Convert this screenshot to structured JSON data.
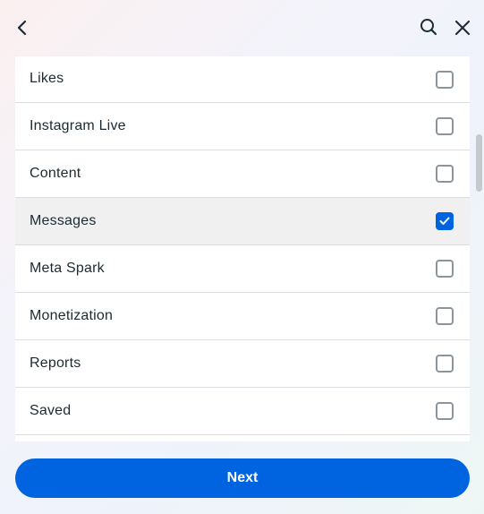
{
  "header": {
    "back_icon": "chevron-left-icon",
    "search_icon": "search-icon",
    "close_icon": "close-icon"
  },
  "list": {
    "items": [
      {
        "label": "Likes",
        "checked": false
      },
      {
        "label": "Instagram Live",
        "checked": false
      },
      {
        "label": "Content",
        "checked": false
      },
      {
        "label": "Messages",
        "checked": true
      },
      {
        "label": "Meta Spark",
        "checked": false
      },
      {
        "label": "Monetization",
        "checked": false
      },
      {
        "label": "Reports",
        "checked": false
      },
      {
        "label": "Saved",
        "checked": false
      },
      {
        "label": "",
        "checked": false
      }
    ]
  },
  "footer": {
    "next_label": "Next"
  },
  "colors": {
    "accent": "#0064e0",
    "selected_row": "#f0f0f0",
    "text": "#1c2b33",
    "checkbox_border": "#8a959e"
  }
}
